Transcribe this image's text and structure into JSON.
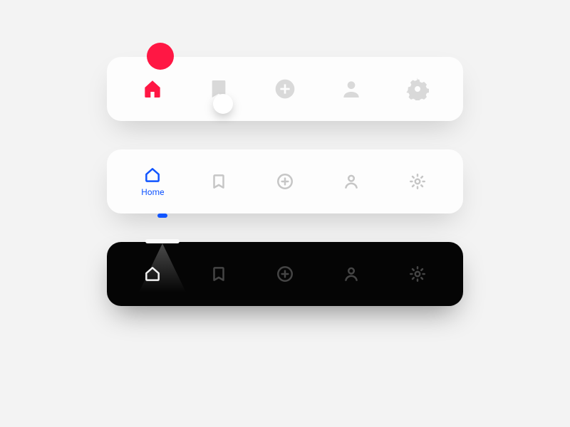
{
  "colors": {
    "accent_red": "#ff1744",
    "accent_blue": "#1155ff",
    "muted_fill": "#d9d9d9",
    "muted_stroke": "#c6c6c6",
    "dark_bg": "#050505",
    "dark_stroke": "#454545",
    "dark_active_stroke": "#f0f0f0"
  },
  "barA": {
    "style": "filled",
    "activeIndex": 0,
    "items": [
      {
        "icon": "home"
      },
      {
        "icon": "bookmark"
      },
      {
        "icon": "plus"
      },
      {
        "icon": "user"
      },
      {
        "icon": "gear"
      }
    ],
    "knob_hover_index": 1
  },
  "barB": {
    "style": "outline",
    "activeIndex": 0,
    "items": [
      {
        "icon": "home",
        "label": "Home"
      },
      {
        "icon": "bookmark"
      },
      {
        "icon": "plus"
      },
      {
        "icon": "user"
      },
      {
        "icon": "gear"
      }
    ]
  },
  "barC": {
    "style": "dark-spotlight",
    "activeIndex": 0,
    "items": [
      {
        "icon": "home"
      },
      {
        "icon": "bookmark"
      },
      {
        "icon": "plus"
      },
      {
        "icon": "user"
      },
      {
        "icon": "gear"
      }
    ]
  }
}
